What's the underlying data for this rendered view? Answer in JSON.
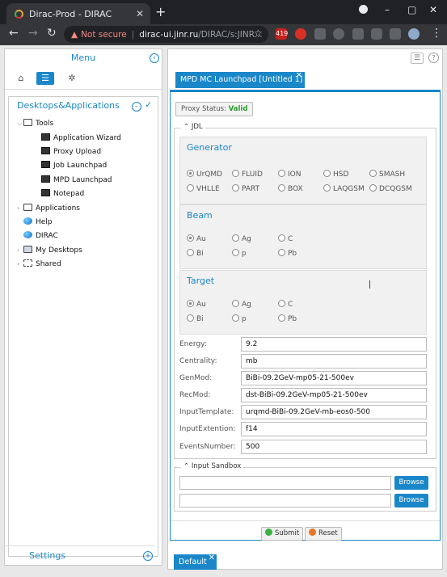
{
  "browser": {
    "tab_title": "Dirac-Prod - DIRAC",
    "tab_close": "✕",
    "new_tab": "+",
    "not_secure": "Not secure",
    "separator": "|",
    "url_host": "dirac-ui.jinr.ru",
    "url_path": "/DIRAC/s:JINR...",
    "gmail_badge": "419",
    "window_min": "–",
    "window_max": "▢",
    "window_close": "✕"
  },
  "menu": {
    "title": "Menu",
    "desktops_title": "Desktops&Applications",
    "settings_label": "Settings",
    "tree": {
      "tools": "Tools",
      "tools_children": [
        "Application Wizard",
        "Proxy Upload",
        "Job Launchpad",
        "MPD Launchpad",
        "Notepad"
      ],
      "applications": "Applications",
      "help": "Help",
      "dirac": "DIRAC",
      "my_desktops": "My Desktops",
      "shared": "Shared"
    }
  },
  "launchpad": {
    "tab_label": "MPD MC Launchpad [Untitled 1]",
    "proxy_status_label": "Proxy Status:",
    "proxy_status_value": "Valid",
    "jdl_legend": "JDL",
    "generator": {
      "title": "Generator",
      "options": [
        "UrQMD",
        "FLUID",
        "ION",
        "HSD",
        "SMASH",
        "VHLLE",
        "PART",
        "BOX",
        "LAQGSM",
        "DCQGSM"
      ],
      "selected": "UrQMD"
    },
    "beam": {
      "title": "Beam",
      "options": [
        "Au",
        "Ag",
        "C",
        "Bi",
        "p",
        "Pb"
      ],
      "selected": "Au"
    },
    "target": {
      "title": "Target",
      "options": [
        "Au",
        "Ag",
        "C",
        "Bi",
        "p",
        "Pb"
      ],
      "selected": "Au"
    },
    "fields": [
      {
        "label": "Energy:",
        "value": "9.2"
      },
      {
        "label": "Centrality:",
        "value": "mb"
      },
      {
        "label": "GenMod:",
        "value": "BiBi-09.2GeV-mp05-21-500ev"
      },
      {
        "label": "RecMod:",
        "value": "dst-BiBi-09.2GeV-mp05-21-500ev"
      },
      {
        "label": "InputTemplate:",
        "value": "urqmd-BiBi-09.2GeV-mb-eos0-500"
      },
      {
        "label": "InputExtention:",
        "value": "f14"
      },
      {
        "label": "EventsNumber:",
        "value": "500"
      }
    ],
    "sandbox_legend": "Input Sandbox",
    "browse_label": "Browse",
    "submit_label": "Submit",
    "reset_label": "Reset"
  },
  "bottom_tab": "Default",
  "colors": {
    "accent": "#1a87c9",
    "valid": "#2b9b2b"
  }
}
